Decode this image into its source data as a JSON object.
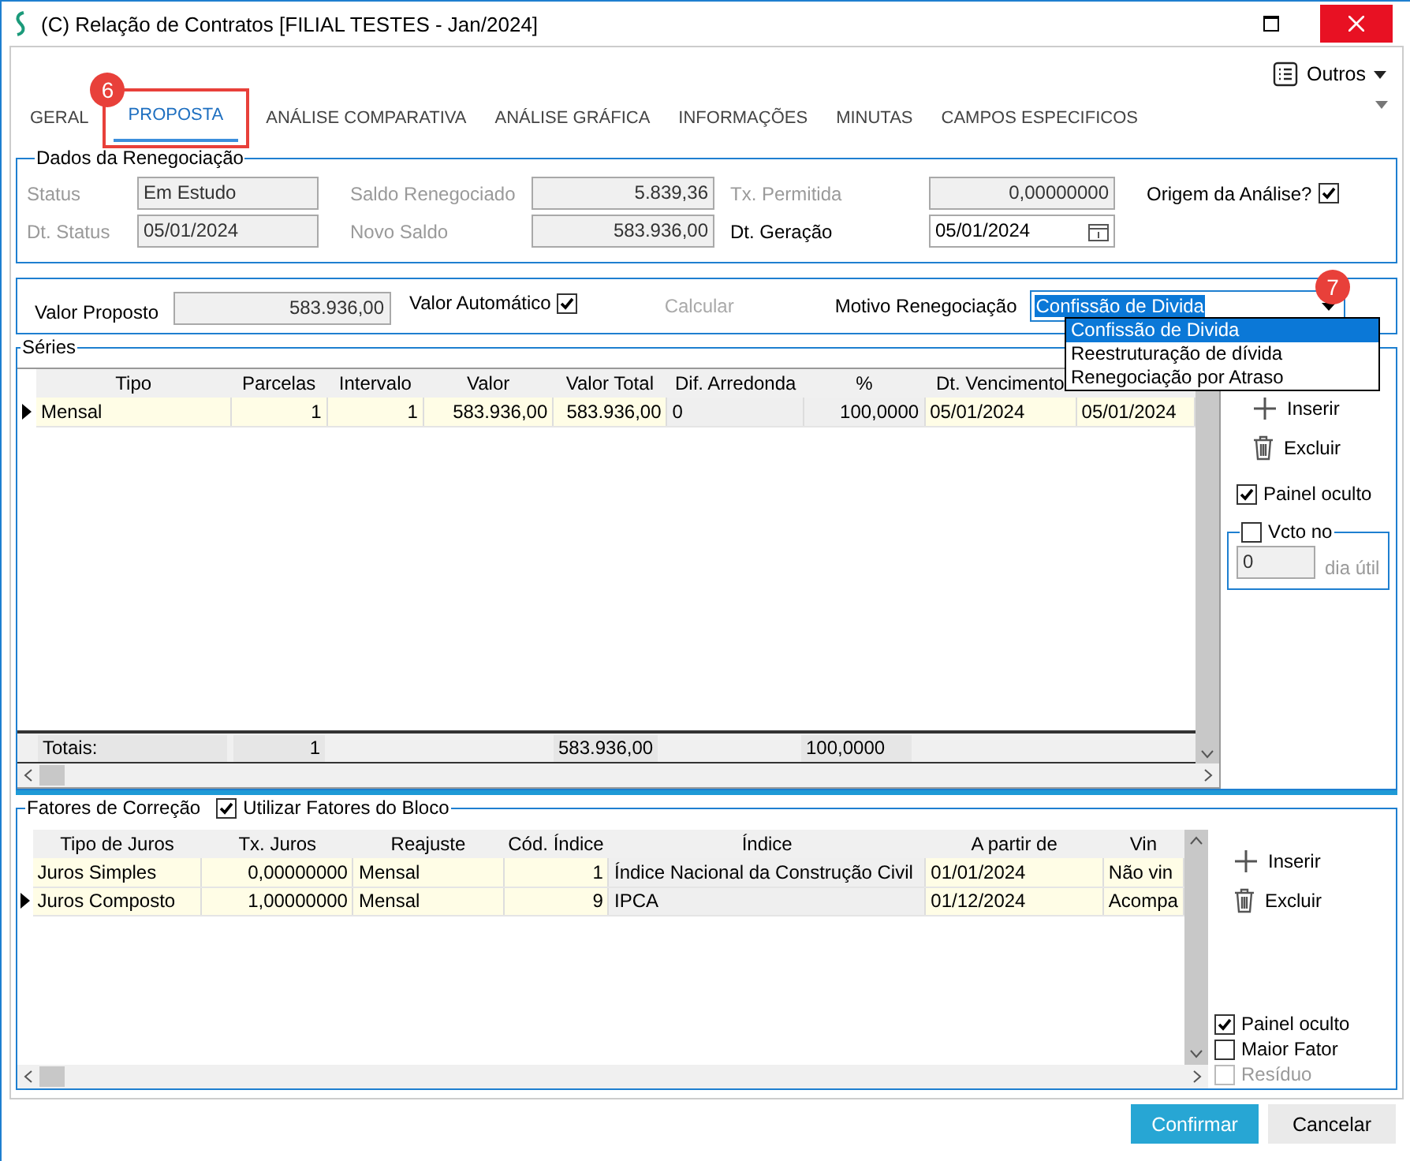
{
  "window": {
    "title": "(C) Relação de Contratos [FILIAL TESTES - Jan/2024]"
  },
  "toolbar": {
    "menu_button": "Outros"
  },
  "tabs": [
    {
      "label": "GERAL",
      "selected": false
    },
    {
      "label": "PROPOSTA",
      "selected": true
    },
    {
      "label": "ANÁLISE COMPARATIVA",
      "selected": false
    },
    {
      "label": "ANÁLISE GRÁFICA",
      "selected": false
    },
    {
      "label": "INFORMAÇÕES",
      "selected": false
    },
    {
      "label": "MINUTAS",
      "selected": false
    },
    {
      "label": "CAMPOS ESPECIFICOS",
      "selected": false
    }
  ],
  "callouts": [
    {
      "label": "6"
    },
    {
      "label": "7"
    }
  ],
  "renegotiation": {
    "title": "Dados da Renegociação",
    "fields": [
      {
        "label": "Status",
        "value": "Em Estudo",
        "disabled": true
      },
      {
        "label": "Dt. Status",
        "value": "05/01/2024",
        "disabled": true
      },
      {
        "label": "Saldo Renegociado",
        "value": "5.839,36",
        "disabled": true
      },
      {
        "label": "Novo Saldo",
        "value": "583.936,00",
        "disabled": true
      },
      {
        "label": "Tx. Permitida",
        "value": "0,00000000",
        "disabled": true
      },
      {
        "label": "Dt. Geração",
        "value": "05/01/2024",
        "disabled": false,
        "kind": "date"
      }
    ],
    "origin": {
      "label": "Origem da Análise?",
      "checked": true
    }
  },
  "proposal": {
    "label": "Valor Proposto",
    "value": "583.936,00",
    "automatic": {
      "label": "Valor Automático",
      "checked": true
    },
    "calculate": {
      "label": "Calcular",
      "disabled": true
    },
    "reason": {
      "label": "Motivo Renegociação",
      "value": "Confissão de Divida",
      "options": [
        {
          "label": "Confissão de Divida",
          "selected": true
        },
        {
          "label": "Reestruturação de dívida",
          "selected": false
        },
        {
          "label": "Renegociação por Atraso",
          "selected": false
        }
      ]
    }
  },
  "series": {
    "title": "Séries",
    "columns": [
      {
        "label": "Tipo",
        "readonly": false
      },
      {
        "label": "Parcelas",
        "readonly": false
      },
      {
        "label": "Intervalo",
        "readonly": false
      },
      {
        "label": "Valor",
        "readonly": false
      },
      {
        "label": "Valor Total",
        "readonly": false
      },
      {
        "label": "Dif. Arredonda",
        "readonly": true
      },
      {
        "label": "%",
        "readonly": true
      },
      {
        "label": "Dt. Vencimento",
        "readonly": false
      }
    ],
    "rows": [
      {
        "current": true,
        "cells": [
          "Mensal",
          "1",
          "1",
          "583.936,00",
          "583.936,00",
          "0",
          "100,0000",
          "05/01/2024",
          "05/01/2024"
        ]
      }
    ],
    "totals": {
      "label": "Totais:",
      "parcelas": "1",
      "valor_total": "583.936,00",
      "percent": "100,0000"
    },
    "actions": [
      {
        "label": "Inserir",
        "kind": "add"
      },
      {
        "label": "Excluir",
        "kind": "delete"
      }
    ],
    "hidden_panel": {
      "label": "Painel oculto",
      "checked": true
    },
    "due": {
      "label": "Vcto no",
      "checked": false,
      "value": "0",
      "suffix": "dia útil"
    }
  },
  "factors": {
    "title": "Fatores de Correção",
    "use_block": {
      "label": "Utilizar Fatores do Bloco",
      "checked": true
    },
    "columns": [
      {
        "label": "Tipo de Juros",
        "readonly": false
      },
      {
        "label": "Tx. Juros",
        "readonly": false
      },
      {
        "label": "Reajuste",
        "readonly": false
      },
      {
        "label": "Cód. Índice",
        "readonly": false
      },
      {
        "label": "Índice",
        "readonly": true
      },
      {
        "label": "A partir de",
        "readonly": false
      },
      {
        "label": "Vin",
        "readonly": false
      }
    ],
    "rows": [
      {
        "current": false,
        "cells": [
          "Juros Simples",
          "0,00000000",
          "Mensal",
          "1",
          "Índice Nacional da Construção Civil",
          "01/01/2024",
          "Não vin"
        ]
      },
      {
        "current": true,
        "cells": [
          "Juros Composto",
          "1,00000000",
          "Mensal",
          "9",
          "IPCA",
          "01/12/2024",
          "Acompa"
        ]
      }
    ],
    "actions": [
      {
        "label": "Inserir",
        "kind": "add"
      },
      {
        "label": "Excluir",
        "kind": "delete"
      }
    ],
    "options": [
      {
        "label": "Painel oculto",
        "checked": true,
        "disabled": false
      },
      {
        "label": "Maior Fator",
        "checked": false,
        "disabled": false
      },
      {
        "label": "Resíduo",
        "checked": false,
        "disabled": true
      }
    ]
  },
  "buttons": [
    {
      "label": "Confirmar",
      "kind": "primary"
    },
    {
      "label": "Cancelar",
      "kind": "secondary"
    }
  ]
}
